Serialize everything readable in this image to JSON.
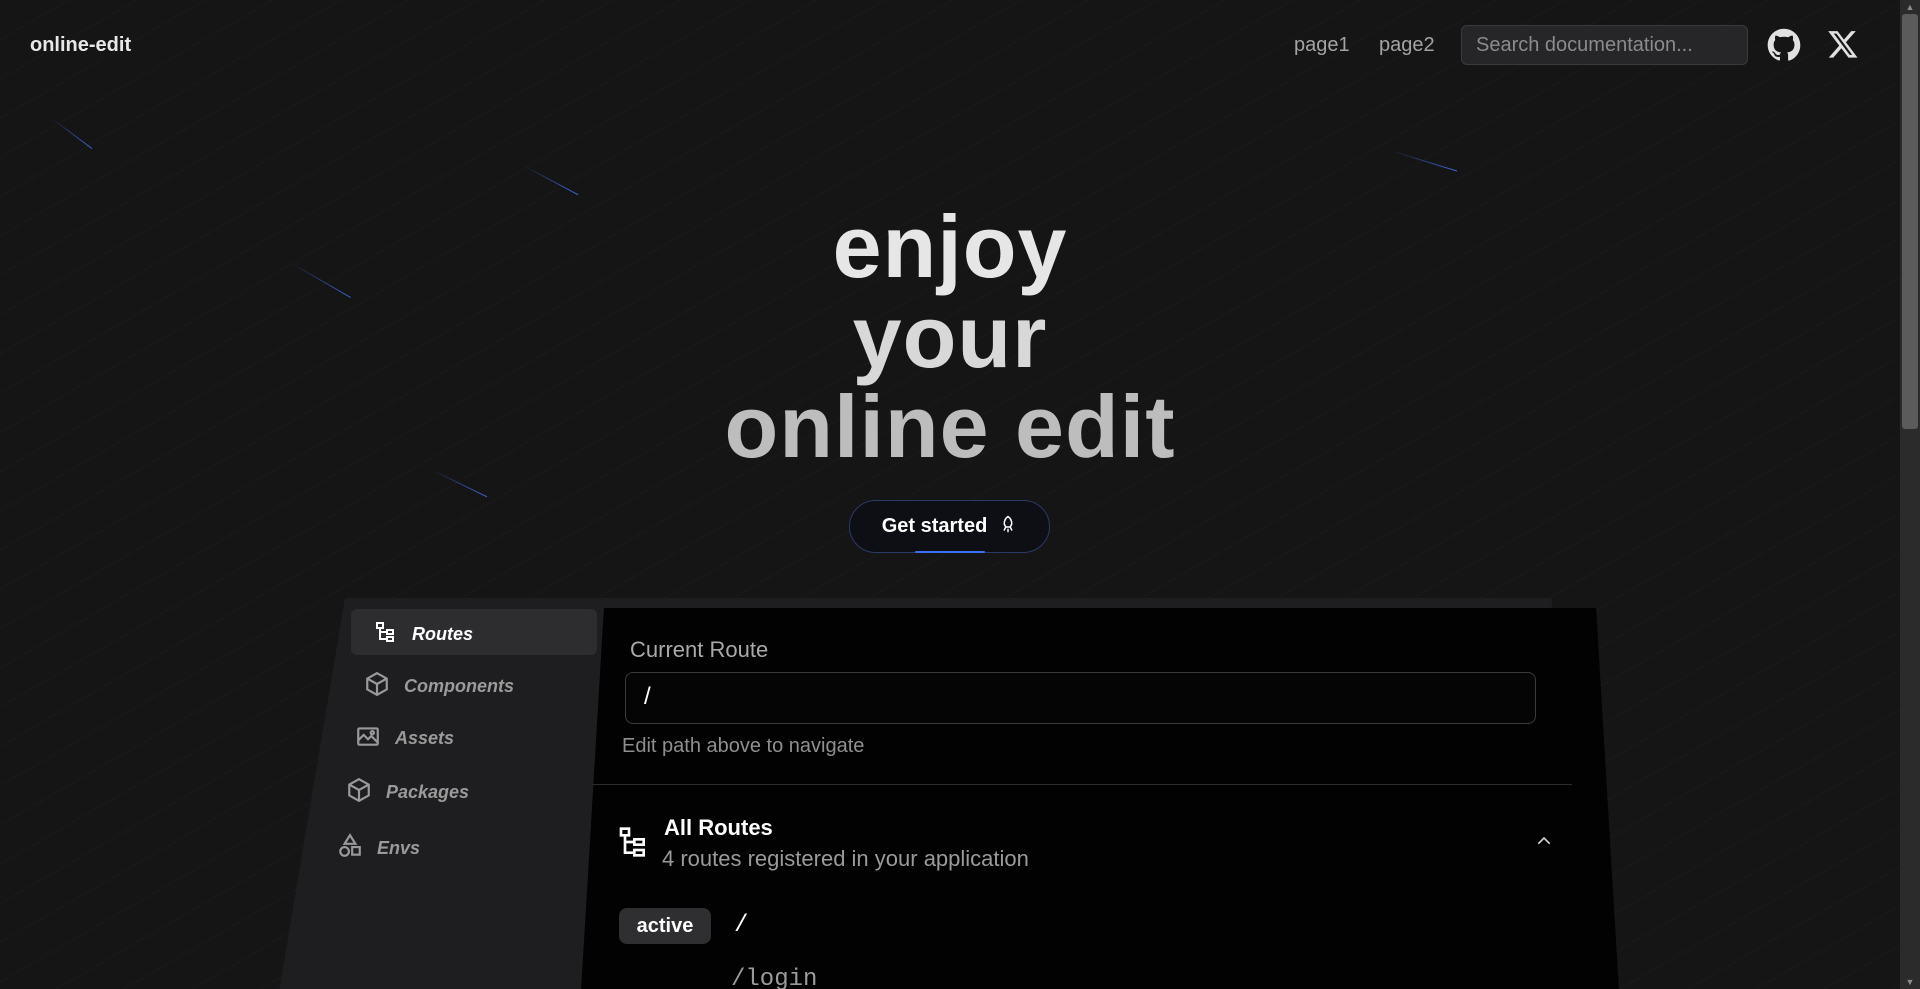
{
  "header": {
    "logo": "online-edit",
    "nav": [
      {
        "label": "page1"
      },
      {
        "label": "page2"
      }
    ],
    "search_placeholder": "Search documentation...",
    "icons": [
      "github-icon",
      "x-icon"
    ]
  },
  "hero": {
    "line1": "enjoy",
    "line2": "your",
    "line3": "online edit",
    "cta_label": "Get started",
    "cta_icon": "rocket-icon"
  },
  "sidebar": {
    "items": [
      {
        "label": "Routes",
        "icon": "route-tree-icon",
        "active": true
      },
      {
        "label": "Components",
        "icon": "hexagon-box-icon",
        "active": false
      },
      {
        "label": "Assets",
        "icon": "image-icon",
        "active": false
      },
      {
        "label": "Packages",
        "icon": "package-icon",
        "active": false
      },
      {
        "label": "Envs",
        "icon": "shapes-icon",
        "active": false
      }
    ]
  },
  "main": {
    "current_route_label": "Current Route",
    "current_route_value": "/",
    "hint": "Edit path above to navigate",
    "all_routes_title": "All Routes",
    "all_routes_subtitle": "4 routes registered in your application",
    "routes": [
      {
        "path": "/",
        "badge": "active"
      },
      {
        "path": "/login",
        "badge": ""
      }
    ]
  },
  "colors": {
    "background": "#151515",
    "accent": "#3b6ef6",
    "panel": "#020202"
  }
}
